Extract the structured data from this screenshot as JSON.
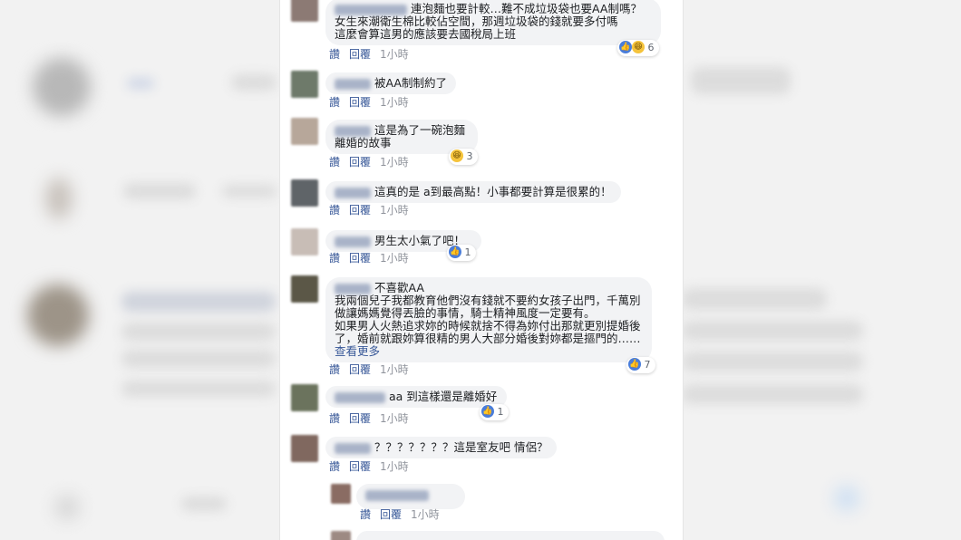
{
  "comments": [
    {
      "text": "連泡麵也要計較…難不成垃圾袋也要AA制嗎？\n女生來潮衛生棉比較佔空間，那週垃圾袋的錢就要多付嗎\n這麼會算這男的應該要去國稅局上班",
      "reply": "回覆",
      "like": "讚",
      "time": "1小時",
      "reaction_count": "6"
    },
    {
      "text": "被AA制制約了",
      "reply": "回覆",
      "like": "讚",
      "time": "1小時"
    },
    {
      "text": "這是為了一碗泡麵\n離婚的故事",
      "reply": "回覆",
      "like": "讚",
      "time": "1小時",
      "reaction_count": "3"
    },
    {
      "text": "這真的是 a到最高點！小事都要計算是很累的！",
      "reply": "回覆",
      "like": "讚",
      "time": "1小時"
    },
    {
      "text": "男生太小氣了吧！",
      "reply": "回覆",
      "like": "讚",
      "time": "1小時",
      "reaction_count": "1"
    },
    {
      "text": "不喜歡AA\n我兩個兒子我都教育他們沒有錢就不要約女孩子出門，千萬別做讓媽媽覺得丟臉的事情，騎士精神風度一定要有。\n如果男人火熱追求妳的時候就捨不得為妳付出那就更別提婚後了，婚前就跟妳算很精的男人大部分婚後對妳都是摳門的……",
      "more": "查看更多",
      "reply": "回覆",
      "like": "讚",
      "time": "1小時",
      "reaction_count": "7"
    },
    {
      "text": "aa 到這樣還是離婚好",
      "reply": "回覆",
      "like": "讚",
      "time": "1小時",
      "reaction_count": "1"
    },
    {
      "text": "？？？？？？？這是室友吧 情侶？",
      "reply": "回覆",
      "like": "讚",
      "time": "1小時"
    },
    {
      "text": "",
      "reply": "回覆",
      "like": "讚",
      "time": "1小時"
    }
  ],
  "colors": {
    "bubble": "#f2f3f5",
    "link": "#385898",
    "meta": "#90949c",
    "like_blue": "#4a7dd9"
  }
}
